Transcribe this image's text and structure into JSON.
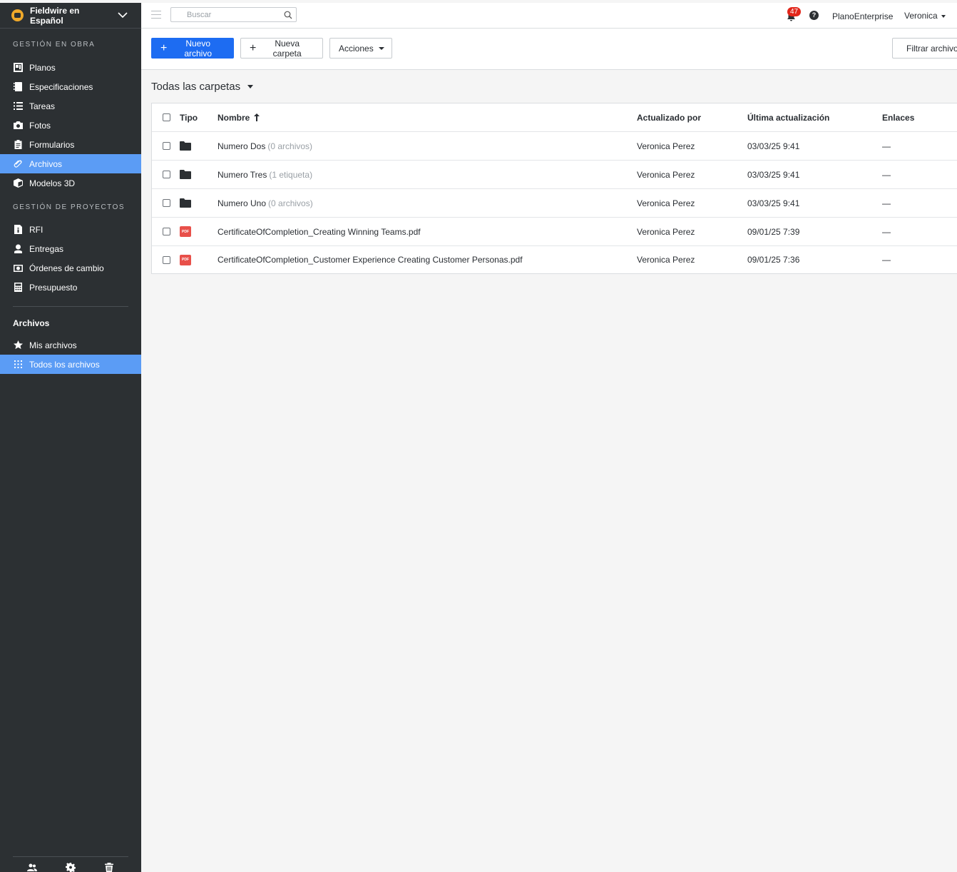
{
  "sidebar": {
    "project_name": "Fieldwire en Español",
    "section_obra": "GESTIÓN EN OBRA",
    "obra_items": [
      {
        "label": "Planos",
        "icon": "plans-icon"
      },
      {
        "label": "Especificaciones",
        "icon": "specifications-icon"
      },
      {
        "label": "Tareas",
        "icon": "tasks-icon"
      },
      {
        "label": "Fotos",
        "icon": "camera-icon"
      },
      {
        "label": "Formularios",
        "icon": "clipboard-icon"
      },
      {
        "label": "Archivos",
        "icon": "paperclip-icon",
        "active": true
      },
      {
        "label": "Modelos 3D",
        "icon": "cube-icon"
      }
    ],
    "section_proyectos": "GESTIÓN DE PROYECTOS",
    "proyecto_items": [
      {
        "label": "RFI",
        "icon": "rfi-icon"
      },
      {
        "label": "Entregas",
        "icon": "user-icon"
      },
      {
        "label": "Órdenes de cambio",
        "icon": "change-order-icon"
      },
      {
        "label": "Presupuesto",
        "icon": "calculator-icon"
      }
    ],
    "files_group_title": "Archivos",
    "files_items": [
      {
        "label": "Mis archivos",
        "icon": "star-icon"
      },
      {
        "label": "Todos los archivos",
        "icon": "grid-icon",
        "active": true
      }
    ]
  },
  "topbar": {
    "search_placeholder": "Buscar",
    "notification_count": "47",
    "help": "?",
    "organization": "PlanoEnterprise",
    "user_name": "Veronica"
  },
  "toolbar": {
    "new_file_label": "Nuevo archivo",
    "new_folder_label": "Nueva carpeta",
    "actions_label": "Acciones",
    "filter_label": "Filtrar archivos"
  },
  "folder_selector": "Todas las carpetas",
  "table": {
    "headers": {
      "type": "Tipo",
      "name": "Nombre",
      "updated_by": "Actualizado por",
      "last_update": "Última actualización",
      "links": "Enlaces"
    },
    "rows": [
      {
        "kind": "folder",
        "name": "Numero Dos",
        "meta": "(0 archivos)",
        "updated_by": "Veronica Perez",
        "date": "03/03/25 9:41",
        "links": "—"
      },
      {
        "kind": "folder",
        "name": "Numero Tres",
        "meta": "(1 etiqueta)",
        "updated_by": "Veronica Perez",
        "date": "03/03/25 9:41",
        "links": "—"
      },
      {
        "kind": "folder",
        "name": "Numero Uno",
        "meta": "(0 archivos)",
        "updated_by": "Veronica Perez",
        "date": "03/03/25 9:41",
        "links": "—"
      },
      {
        "kind": "pdf",
        "name": "CertificateOfCompletion_Creating Winning Teams.pdf",
        "meta": "",
        "updated_by": "Veronica Perez",
        "date": "09/01/25 7:39",
        "links": "—"
      },
      {
        "kind": "pdf",
        "name": "CertificateOfCompletion_Customer Experience Creating Customer Personas.pdf",
        "meta": "",
        "updated_by": "Veronica Perez",
        "date": "09/01/25 7:36",
        "links": "—"
      }
    ],
    "pdf_badge": "PDF"
  },
  "colors": {
    "sidebar_bg": "#2c3033",
    "active_item": "#5b9cf5",
    "primary_button": "#1d6cf2",
    "badge": "#e2261a",
    "pdf": "#e8504a"
  }
}
